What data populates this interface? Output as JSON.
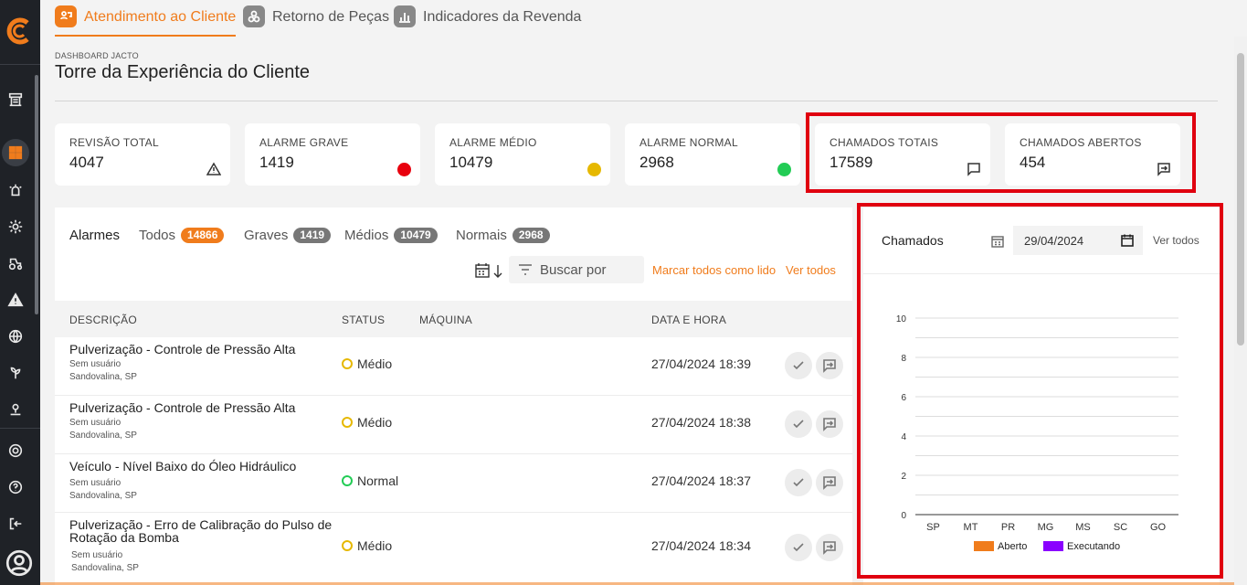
{
  "tabs": [
    {
      "label": "Atendimento ao Cliente",
      "active": true,
      "icon": "chat-users-icon"
    },
    {
      "label": "Retorno de Peças",
      "active": false,
      "icon": "parts-icon"
    },
    {
      "label": "Indicadores da Revenda",
      "active": false,
      "icon": "bar-chart-icon"
    }
  ],
  "header": {
    "overline": "DASHBOARD JACTO",
    "title": "Torre da Experiência do Cliente"
  },
  "cards": [
    {
      "label": "REVISÃO TOTAL",
      "value": "4047",
      "mark": "warning-icon"
    },
    {
      "label": "ALARME GRAVE",
      "value": "1419",
      "mark": "red-dot",
      "color": "#e8000e"
    },
    {
      "label": "ALARME MÉDIO",
      "value": "10479",
      "mark": "yellow-dot",
      "color": "#e6b800"
    },
    {
      "label": "ALARME NORMAL",
      "value": "2968",
      "mark": "green-dot",
      "color": "#22cc55"
    },
    {
      "label": "CHAMADOS TOTAIS",
      "value": "17589",
      "mark": "chat-icon"
    },
    {
      "label": "CHAMADOS ABERTOS",
      "value": "454",
      "mark": "open-ticket-icon"
    }
  ],
  "alarms": {
    "title": "Alarmes",
    "filters": [
      {
        "label": "Todos",
        "count": "14866",
        "color": "#f07c1c"
      },
      {
        "label": "Graves",
        "count": "1419",
        "color": "#777777"
      },
      {
        "label": "Médios",
        "count": "10479",
        "color": "#777777"
      },
      {
        "label": "Normais",
        "count": "2968",
        "color": "#777777"
      }
    ],
    "search_placeholder": "Buscar por",
    "mark_all_read": "Marcar todos como lido",
    "view_all": "Ver todos",
    "columns": [
      "DESCRIÇÃO",
      "STATUS",
      "MÁQUINA",
      "DATA E HORA"
    ],
    "rows": [
      {
        "title": "Pulverização - Controle de Pressão Alta",
        "user": "Sem usuário",
        "city": "Sandovalina, SP",
        "status": "Médio",
        "status_color": "#e6b800",
        "machine": "",
        "datetime": "27/04/2024 18:39"
      },
      {
        "title": "Pulverização - Controle de Pressão Alta",
        "user": "Sem usuário",
        "city": "Sandovalina, SP",
        "status": "Médio",
        "status_color": "#e6b800",
        "machine": "",
        "datetime": "27/04/2024 18:38"
      },
      {
        "title": "Veículo - Nível Baixo do Óleo Hidráulico",
        "user": "Sem usuário",
        "city": "Sandovalina, SP",
        "status": "Normal",
        "status_color": "#22cc55",
        "machine": "",
        "datetime": "27/04/2024 18:37"
      },
      {
        "title": "Pulverização - Erro de Calibração do Pulso de Rotação da Bomba",
        "user": "Sem usuário",
        "city": "Sandovalina, SP",
        "status": "Médio",
        "status_color": "#e6b800",
        "machine": "",
        "datetime": "27/04/2024 18:34"
      }
    ]
  },
  "chamados": {
    "title": "Chamados",
    "date_value": "29/04/2024",
    "view_all": "Ver todos"
  },
  "chart_data": {
    "type": "bar",
    "categories": [
      "SP",
      "MT",
      "PR",
      "MG",
      "MS",
      "SC",
      "GO"
    ],
    "series": [
      {
        "name": "Aberto",
        "color": "#f07c1c",
        "values": [
          0,
          0,
          0,
          0,
          0,
          0,
          0
        ]
      },
      {
        "name": "Executando",
        "color": "#8a00ff",
        "values": [
          0,
          0,
          0,
          0,
          0,
          0,
          0
        ]
      }
    ],
    "ylim": [
      0,
      10
    ],
    "yticks": [
      0,
      2,
      4,
      6,
      8,
      10
    ],
    "grid": true,
    "legend": "bottom"
  }
}
